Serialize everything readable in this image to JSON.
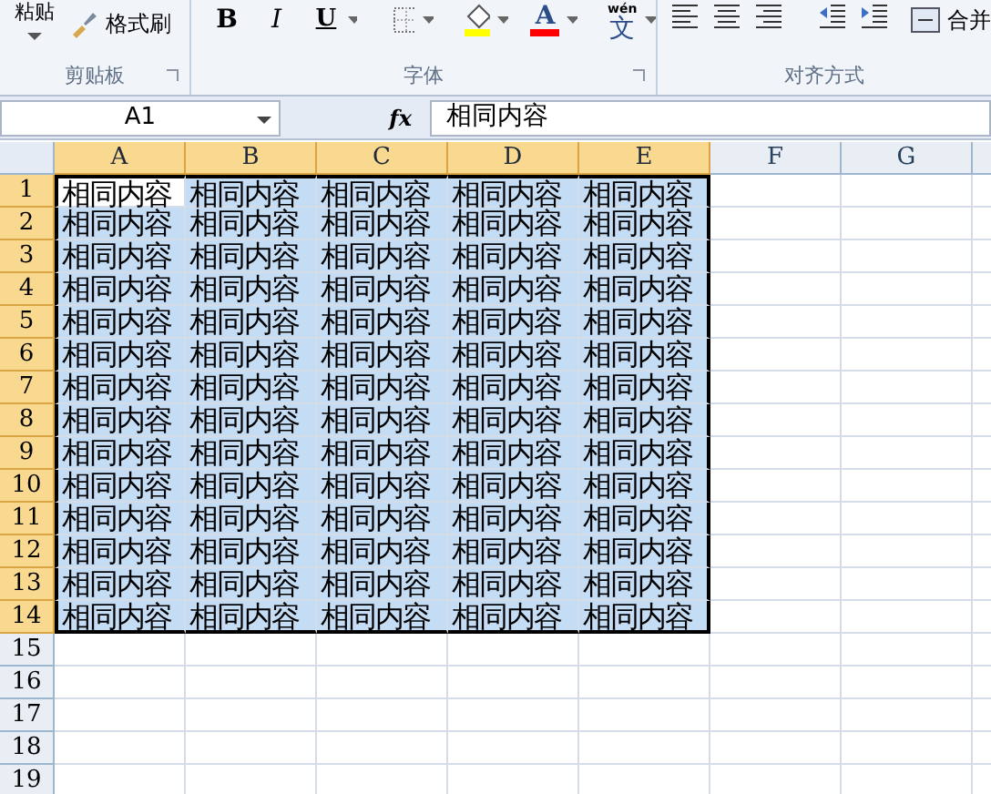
{
  "ribbon": {
    "clipboard": {
      "paste": "粘贴",
      "format_painter": "格式刷",
      "label": "剪贴板"
    },
    "font": {
      "bold": "B",
      "italic": "I",
      "underline": "U",
      "font_color": "A",
      "phonetic_top": "wén",
      "phonetic": "文",
      "label": "字体"
    },
    "alignment": {
      "merge": "合并",
      "label": "对齐方式"
    }
  },
  "formula_bar": {
    "name_box": "A1",
    "fx": "fx",
    "value": "相同内容"
  },
  "columns": [
    {
      "label": "A",
      "selected": true
    },
    {
      "label": "B",
      "selected": true
    },
    {
      "label": "C",
      "selected": true
    },
    {
      "label": "D",
      "selected": true
    },
    {
      "label": "E",
      "selected": true
    },
    {
      "label": "F",
      "selected": false
    },
    {
      "label": "G",
      "selected": false
    }
  ],
  "rows": [
    {
      "number": "1",
      "selected": true,
      "cells": [
        {
          "text": "相同内容",
          "active": true
        },
        {
          "text": "相同内容",
          "active": false
        },
        {
          "text": "相同内容",
          "active": false
        },
        {
          "text": "相同内容",
          "active": false
        },
        {
          "text": "相同内容",
          "active": false
        }
      ]
    },
    {
      "number": "2",
      "selected": true,
      "cells": [
        {
          "text": "相同内容",
          "active": false
        },
        {
          "text": "相同内容",
          "active": false
        },
        {
          "text": "相同内容",
          "active": false
        },
        {
          "text": "相同内容",
          "active": false
        },
        {
          "text": "相同内容",
          "active": false
        }
      ]
    },
    {
      "number": "3",
      "selected": true,
      "cells": [
        {
          "text": "相同内容",
          "active": false
        },
        {
          "text": "相同内容",
          "active": false
        },
        {
          "text": "相同内容",
          "active": false
        },
        {
          "text": "相同内容",
          "active": false
        },
        {
          "text": "相同内容",
          "active": false
        }
      ]
    },
    {
      "number": "4",
      "selected": true,
      "cells": [
        {
          "text": "相同内容",
          "active": false
        },
        {
          "text": "相同内容",
          "active": false
        },
        {
          "text": "相同内容",
          "active": false
        },
        {
          "text": "相同内容",
          "active": false
        },
        {
          "text": "相同内容",
          "active": false
        }
      ]
    },
    {
      "number": "5",
      "selected": true,
      "cells": [
        {
          "text": "相同内容",
          "active": false
        },
        {
          "text": "相同内容",
          "active": false
        },
        {
          "text": "相同内容",
          "active": false
        },
        {
          "text": "相同内容",
          "active": false
        },
        {
          "text": "相同内容",
          "active": false
        }
      ]
    },
    {
      "number": "6",
      "selected": true,
      "cells": [
        {
          "text": "相同内容",
          "active": false
        },
        {
          "text": "相同内容",
          "active": false
        },
        {
          "text": "相同内容",
          "active": false
        },
        {
          "text": "相同内容",
          "active": false
        },
        {
          "text": "相同内容",
          "active": false
        }
      ]
    },
    {
      "number": "7",
      "selected": true,
      "cells": [
        {
          "text": "相同内容",
          "active": false
        },
        {
          "text": "相同内容",
          "active": false
        },
        {
          "text": "相同内容",
          "active": false
        },
        {
          "text": "相同内容",
          "active": false
        },
        {
          "text": "相同内容",
          "active": false
        }
      ]
    },
    {
      "number": "8",
      "selected": true,
      "cells": [
        {
          "text": "相同内容",
          "active": false
        },
        {
          "text": "相同内容",
          "active": false
        },
        {
          "text": "相同内容",
          "active": false
        },
        {
          "text": "相同内容",
          "active": false
        },
        {
          "text": "相同内容",
          "active": false
        }
      ]
    },
    {
      "number": "9",
      "selected": true,
      "cells": [
        {
          "text": "相同内容",
          "active": false
        },
        {
          "text": "相同内容",
          "active": false
        },
        {
          "text": "相同内容",
          "active": false
        },
        {
          "text": "相同内容",
          "active": false
        },
        {
          "text": "相同内容",
          "active": false
        }
      ]
    },
    {
      "number": "10",
      "selected": true,
      "cells": [
        {
          "text": "相同内容",
          "active": false
        },
        {
          "text": "相同内容",
          "active": false
        },
        {
          "text": "相同内容",
          "active": false
        },
        {
          "text": "相同内容",
          "active": false
        },
        {
          "text": "相同内容",
          "active": false
        }
      ]
    },
    {
      "number": "11",
      "selected": true,
      "cells": [
        {
          "text": "相同内容",
          "active": false
        },
        {
          "text": "相同内容",
          "active": false
        },
        {
          "text": "相同内容",
          "active": false
        },
        {
          "text": "相同内容",
          "active": false
        },
        {
          "text": "相同内容",
          "active": false
        }
      ]
    },
    {
      "number": "12",
      "selected": true,
      "cells": [
        {
          "text": "相同内容",
          "active": false
        },
        {
          "text": "相同内容",
          "active": false
        },
        {
          "text": "相同内容",
          "active": false
        },
        {
          "text": "相同内容",
          "active": false
        },
        {
          "text": "相同内容",
          "active": false
        }
      ]
    },
    {
      "number": "13",
      "selected": true,
      "cells": [
        {
          "text": "相同内容",
          "active": false
        },
        {
          "text": "相同内容",
          "active": false
        },
        {
          "text": "相同内容",
          "active": false
        },
        {
          "text": "相同内容",
          "active": false
        },
        {
          "text": "相同内容",
          "active": false
        }
      ]
    },
    {
      "number": "14",
      "selected": true,
      "cells": [
        {
          "text": "相同内容",
          "active": false
        },
        {
          "text": "相同内容",
          "active": false
        },
        {
          "text": "相同内容",
          "active": false
        },
        {
          "text": "相同内容",
          "active": false
        },
        {
          "text": "相同内容",
          "active": false
        }
      ]
    },
    {
      "number": "15",
      "selected": false,
      "cells": []
    },
    {
      "number": "16",
      "selected": false,
      "cells": []
    },
    {
      "number": "17",
      "selected": false,
      "cells": []
    },
    {
      "number": "18",
      "selected": false,
      "cells": []
    },
    {
      "number": "19",
      "selected": false,
      "cells": []
    }
  ]
}
